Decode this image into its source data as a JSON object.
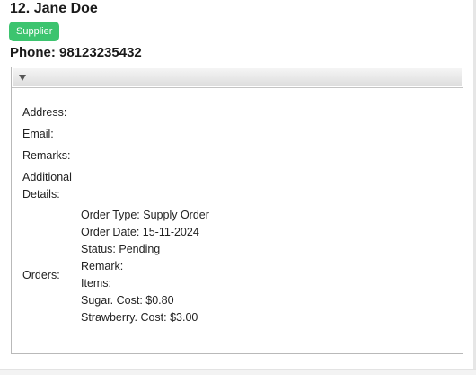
{
  "contact": {
    "title": "12. Jane Doe",
    "tag": "Supplier",
    "phone": "Phone: 98123235432"
  },
  "details": {
    "address_label": "Address:",
    "email_label": "Email:",
    "remarks_label": "Remarks:",
    "additional_label": "Additional Details:",
    "orders_label": "Orders:",
    "orders_lines": [
      "Order Type: Supply Order",
      "Order Date: 15-11-2024",
      "Status: Pending",
      "Remark:",
      "Items:",
      "Sugar. Cost: $0.80",
      "Strawberry. Cost: $3.00"
    ]
  },
  "colors": {
    "tag_background": "#3cc46f",
    "tag_text": "#ffffff"
  },
  "icons": {
    "toggle": "triangle-down-icon"
  }
}
